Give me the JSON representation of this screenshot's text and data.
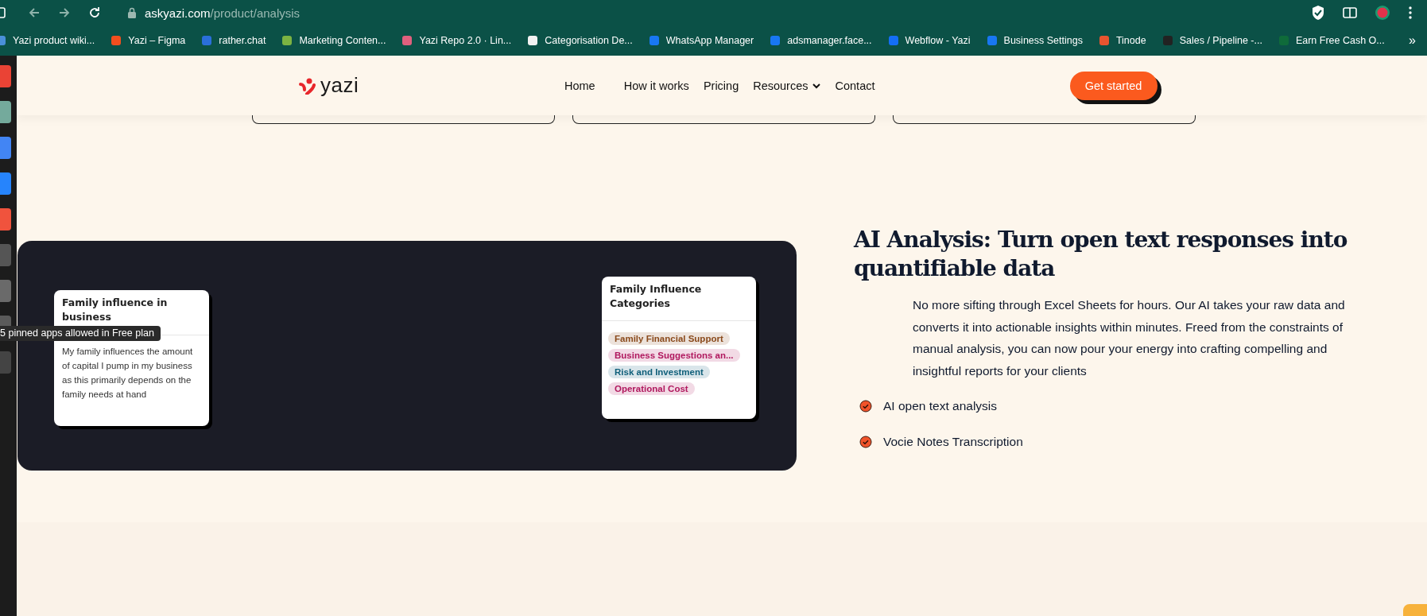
{
  "browser": {
    "url_host": "askyazi.com",
    "url_path": "/product/analysis",
    "bookmarks": [
      {
        "label": "Yazi product wiki...",
        "color": "#4a90d9"
      },
      {
        "label": "Yazi – Figma",
        "color": "#f24e1e"
      },
      {
        "label": "rather.chat",
        "color": "#2a6fdb"
      },
      {
        "label": "Marketing Conten...",
        "color": "#7cb342"
      },
      {
        "label": "Yazi Repo 2.0 · Lin...",
        "color": "#e0607e"
      },
      {
        "label": "Categorisation De...",
        "color": "#f2f2f2"
      },
      {
        "label": "WhatsApp Manager",
        "color": "#1877f2"
      },
      {
        "label": "adsmanager.face...",
        "color": "#1877f2"
      },
      {
        "label": "Webflow - Yazi",
        "color": "#146ef5"
      },
      {
        "label": "Business Settings",
        "color": "#1877f2"
      },
      {
        "label": "Tinode",
        "color": "#e8542f"
      },
      {
        "label": "Sales / Pipeline -...",
        "color": "#222222"
      },
      {
        "label": "Earn Free Cash O...",
        "color": "#0f6b3a"
      }
    ],
    "more": "»"
  },
  "dock": {
    "apps": [
      {
        "color": "#ea4335"
      },
      {
        "color": "#74aa9c"
      },
      {
        "color": "#4285f4"
      },
      {
        "color": "#2684fc"
      },
      {
        "color": "#f0533d"
      },
      {
        "color": "#555555"
      },
      {
        "color": "#6a6a6a"
      },
      {
        "color": "#5a5a5a"
      },
      {
        "color": "#444444"
      }
    ],
    "tooltip": "5 pinned apps allowed in Free plan"
  },
  "nav": {
    "logo": "yazi",
    "links": [
      {
        "label": "Home",
        "kind": "link"
      },
      {
        "label": "How it works",
        "kind": "link"
      },
      {
        "label": "Pricing",
        "kind": "link"
      },
      {
        "label": "Resources",
        "kind": "dropdown"
      },
      {
        "label": "Contact",
        "kind": "link"
      }
    ],
    "cta": "Get started"
  },
  "feature": {
    "response_card": {
      "title": "Family influence in business",
      "text": "My family influences the amount of capital I pump in my business as this primarily depends on the family needs at hand"
    },
    "categories_card": {
      "title": "Family Influence Categories",
      "tags": [
        {
          "label": "Family Financial Support",
          "color": "#8a4a1c"
        },
        {
          "label": "Business Suggestions an...",
          "color": "#b0185e"
        },
        {
          "label": "Risk and Investment",
          "color": "#0f5f7a"
        },
        {
          "label": "Operational Cost",
          "color": "#b0185e"
        }
      ]
    },
    "heading": "AI Analysis: Turn open text responses into quantifiable data",
    "description": "No more sifting through Excel Sheets for hours. Our AI takes your raw data and converts it into actionable insights within minutes. Freed from the constraints of manual analysis, you can now pour your energy into crafting compelling and insightful reports for your clients",
    "checklist": [
      "AI open text analysis",
      "Vocie Notes Transcription"
    ]
  }
}
